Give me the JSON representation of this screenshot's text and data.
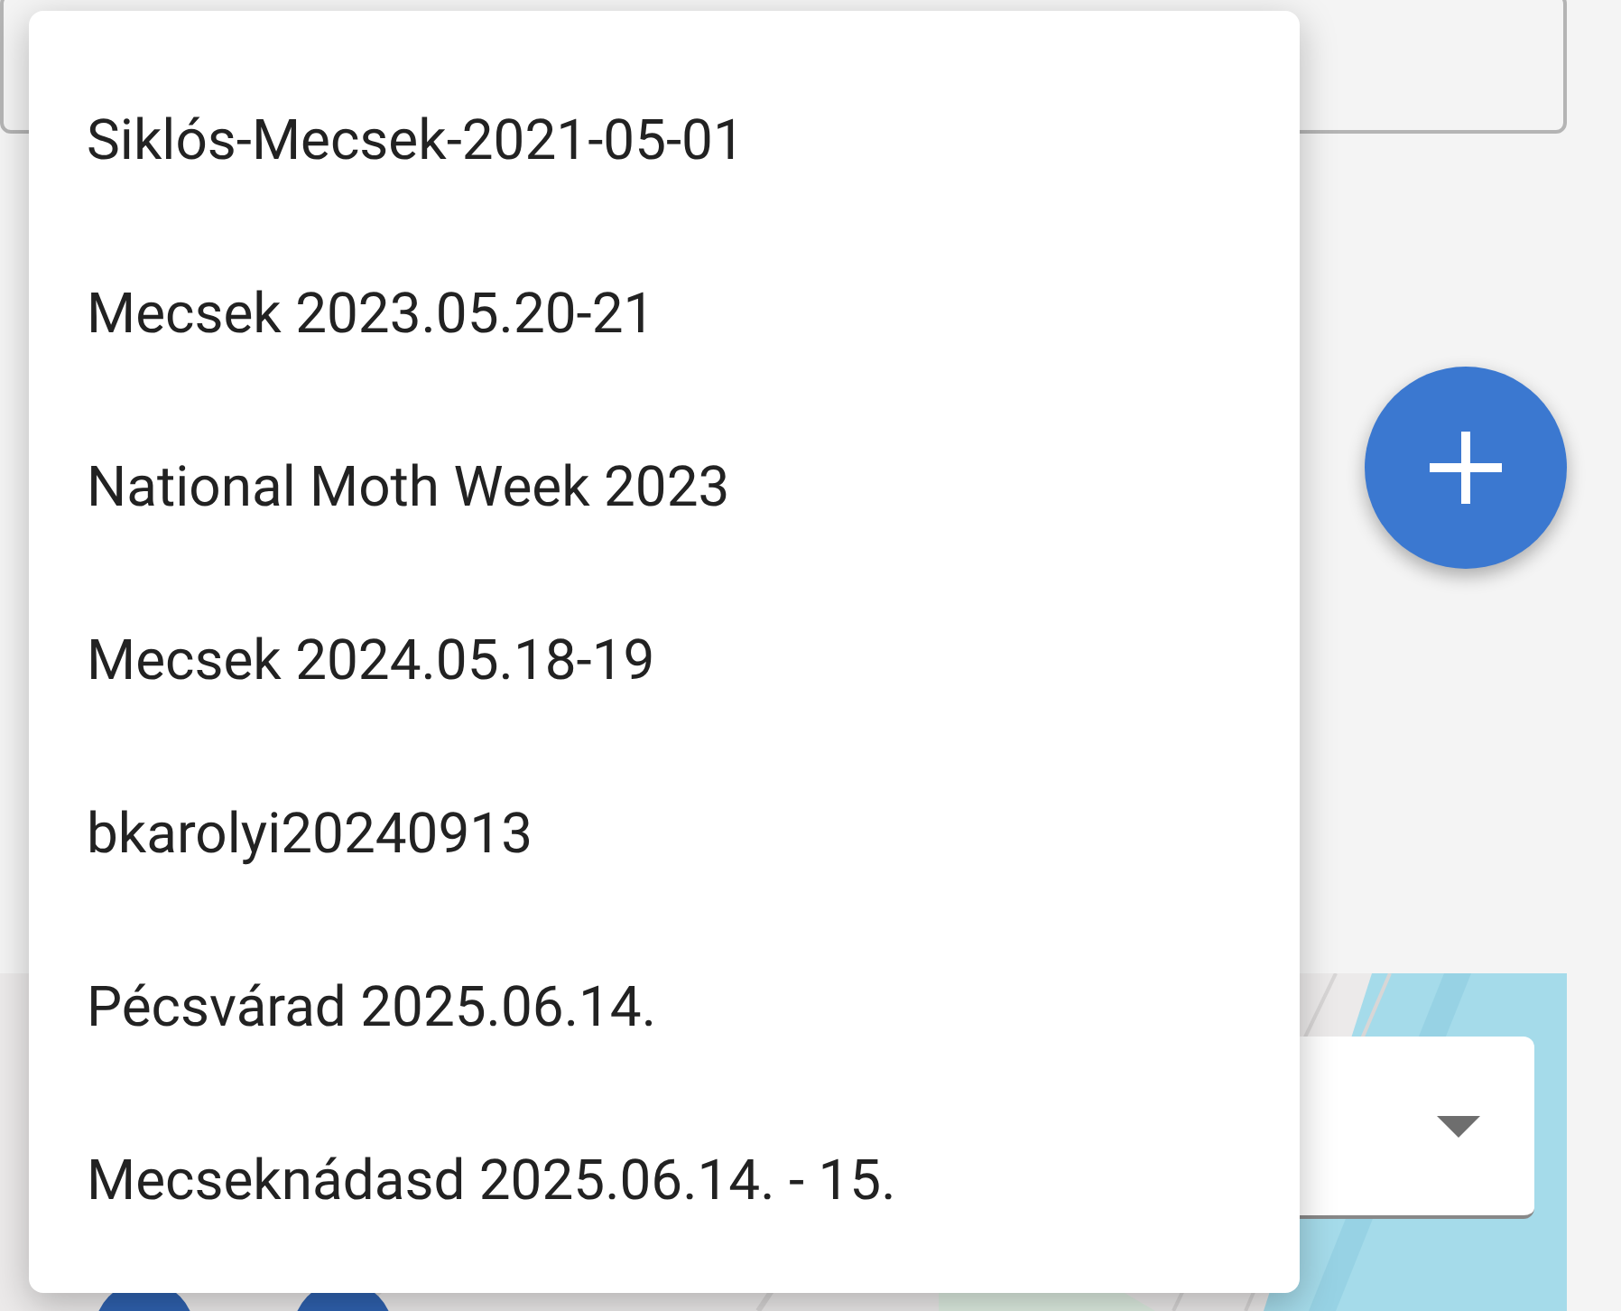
{
  "menu": {
    "items": [
      "Siklós-Mecsek-2021-05-01",
      "Mecsek 2023.05.20-21",
      "National Moth Week 2023",
      "Mecsek 2024.05.18-19",
      "bkarolyi20240913",
      "Pécsvárad 2025.06.14.",
      "Mecseknádasd 2025.06.14. - 15."
    ]
  }
}
